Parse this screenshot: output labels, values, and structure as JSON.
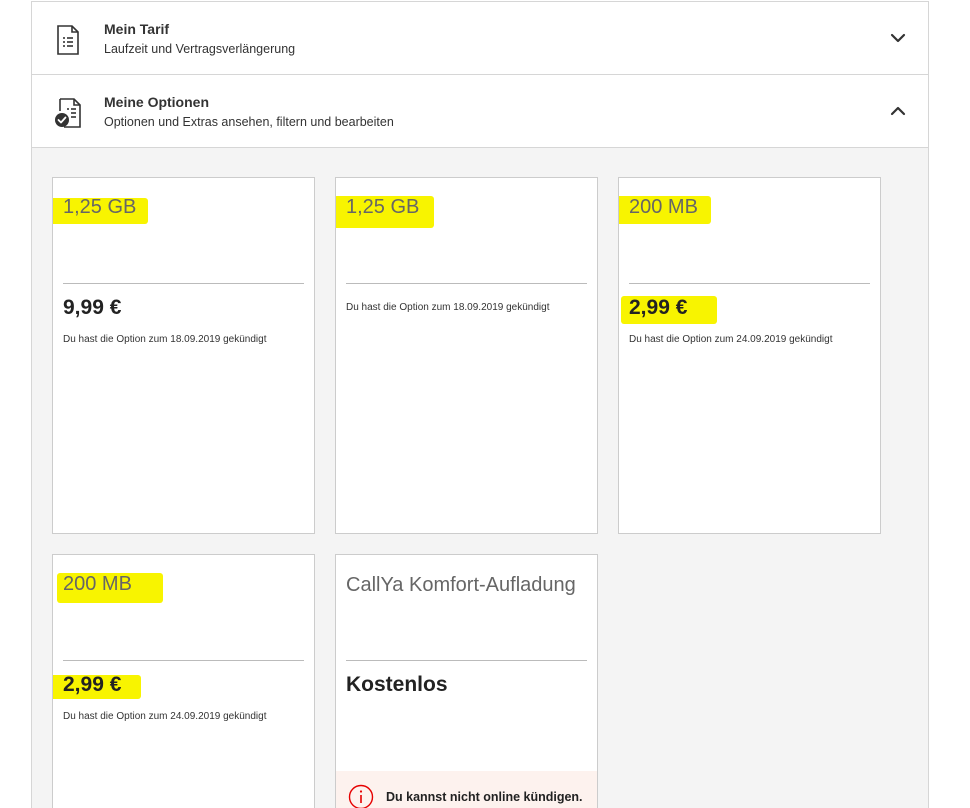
{
  "accordion": [
    {
      "title": "Mein Tarif",
      "subtitle": "Laufzeit und Vertragsverlängerung",
      "chevron": "chevron-down-icon",
      "icon": "document-list-icon"
    },
    {
      "title": "Meine Optionen",
      "subtitle": "Optionen und Extras ansehen, filtern und bearbeiten",
      "chevron": "chevron-up-icon",
      "icon": "document-check-icon"
    }
  ],
  "cards": [
    {
      "title": "1,25 GB",
      "price": "9,99 €",
      "note": "Du hast die Option zum 18.09.2019 gekündigt"
    },
    {
      "title": "1,25 GB",
      "price": "",
      "note": "Du hast die Option zum 18.09.2019 gekündigt"
    },
    {
      "title": "200 MB",
      "price": "2,99 €",
      "note": "Du hast die Option zum 24.09.2019 gekündigt"
    },
    {
      "title": "200 MB",
      "price": "2,99 €",
      "note": "Du hast die Option zum 24.09.2019 gekündigt"
    },
    {
      "title": "CallYa Komfort-Aufladung",
      "price": "Kostenlos",
      "note": "Du kannst nicht online kündigen.",
      "notice_icon": "info-icon"
    }
  ],
  "colors": {
    "highlight": "#f8f400",
    "notice_background": "#fdf2ee",
    "notice_accent": "#e60000"
  }
}
